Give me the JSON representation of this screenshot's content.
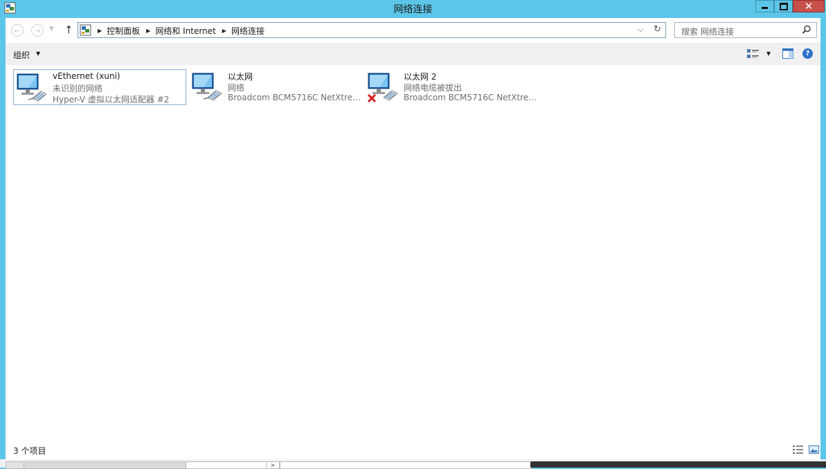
{
  "window": {
    "title": "网络连接"
  },
  "nav": {
    "breadcrumbs": [
      "控制面板",
      "网络和 Internet",
      "网络连接"
    ],
    "search_placeholder": "搜索 网络连接"
  },
  "toolbar": {
    "organize_label": "组织"
  },
  "items": [
    {
      "name": "vEthernet (xuni)",
      "status": "未识别的网络",
      "device": "Hyper-V 虚拟以太网适配器 #2",
      "selected": true,
      "disconnected": false
    },
    {
      "name": "以太网",
      "status": "网络",
      "device": "Broadcom BCM5716C NetXtre...",
      "selected": false,
      "disconnected": false
    },
    {
      "name": "以太网 2",
      "status": "网络电缆被拔出",
      "device": "Broadcom BCM5716C NetXtre...",
      "selected": false,
      "disconnected": true
    }
  ],
  "statusbar": {
    "count_label": "3 个项目"
  },
  "colors": {
    "frame": "#5cc6e8",
    "close_button": "#c7504b",
    "selection_border": "#84acd6",
    "disconnected_x": "#d81e1e"
  }
}
